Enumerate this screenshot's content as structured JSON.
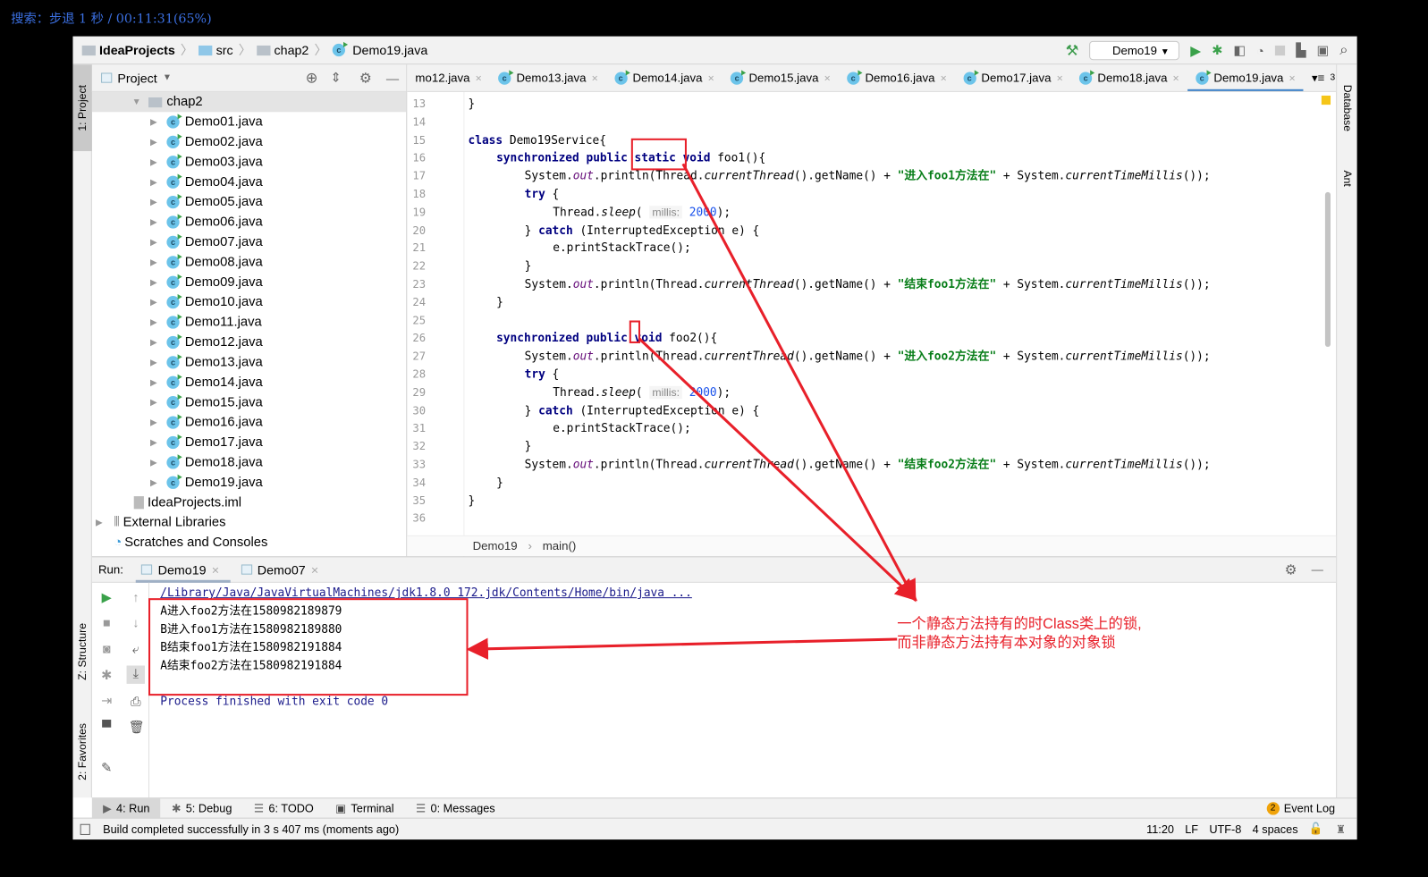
{
  "overlay": {
    "osd_text": "搜索：步退 1 秒 / 00:11:31(65%)"
  },
  "navbar": {
    "crumbs": [
      "IdeaProjects",
      "src",
      "chap2",
      "Demo19.java"
    ],
    "run_config": "Demo19"
  },
  "left_stripe": {
    "project": "1: Project",
    "structure": "Z: Structure",
    "favorites": "2: Favorites"
  },
  "right_stripe": {
    "database": "Database",
    "ant": "Ant"
  },
  "project": {
    "title": "Project",
    "folder": "chap2",
    "files": [
      "Demo01.java",
      "Demo02.java",
      "Demo03.java",
      "Demo04.java",
      "Demo05.java",
      "Demo06.java",
      "Demo07.java",
      "Demo08.java",
      "Demo09.java",
      "Demo10.java",
      "Demo11.java",
      "Demo12.java",
      "Demo13.java",
      "Demo14.java",
      "Demo15.java",
      "Demo16.java",
      "Demo17.java",
      "Demo18.java",
      "Demo19.java"
    ],
    "iml": "IdeaProjects.iml",
    "external": "External Libraries",
    "scratches": "Scratches and Consoles"
  },
  "tabs": {
    "items": [
      "mo12.java",
      "Demo13.java",
      "Demo14.java",
      "Demo15.java",
      "Demo16.java",
      "Demo17.java",
      "Demo18.java",
      "Demo19.java"
    ],
    "active": "Demo19.java",
    "overflow": "3"
  },
  "editor": {
    "lines": [
      {
        "n": "13",
        "indent": 0,
        "t": [
          [
            "p",
            "}"
          ]
        ]
      },
      {
        "n": "14",
        "indent": 0,
        "t": []
      },
      {
        "n": "15",
        "indent": 0,
        "t": [
          [
            "kw",
            "class"
          ],
          [
            "p",
            " Demo19Service{"
          ]
        ]
      },
      {
        "n": "16",
        "indent": 1,
        "t": [
          [
            "kw",
            "synchronized public static void"
          ],
          [
            "p",
            " foo1(){"
          ]
        ]
      },
      {
        "n": "17",
        "indent": 2,
        "t": [
          [
            "p",
            "System."
          ],
          [
            "fld",
            "out"
          ],
          [
            "p",
            ".println(Thread."
          ],
          [
            "it",
            "currentThread"
          ],
          [
            "p",
            "().getName() + "
          ],
          [
            "str",
            "\"进入foo1方法在\""
          ],
          [
            "p",
            " + System."
          ],
          [
            "it",
            "currentTimeMillis"
          ],
          [
            "p",
            "());"
          ]
        ]
      },
      {
        "n": "18",
        "indent": 2,
        "t": [
          [
            "kw",
            "try"
          ],
          [
            "p",
            " {"
          ]
        ]
      },
      {
        "n": "19",
        "indent": 3,
        "t": [
          [
            "p",
            "Thread."
          ],
          [
            "it",
            "sleep"
          ],
          [
            "p",
            "( "
          ],
          [
            "hint",
            "millis:"
          ],
          [
            "p",
            " "
          ],
          [
            "num",
            "2000"
          ],
          [
            "p",
            ");"
          ]
        ]
      },
      {
        "n": "20",
        "indent": 2,
        "t": [
          [
            "p",
            "} "
          ],
          [
            "kw",
            "catch"
          ],
          [
            "p",
            " (InterruptedException e) {"
          ]
        ]
      },
      {
        "n": "21",
        "indent": 3,
        "t": [
          [
            "p",
            "e.printStackTrace();"
          ]
        ]
      },
      {
        "n": "22",
        "indent": 2,
        "t": [
          [
            "p",
            "}"
          ]
        ]
      },
      {
        "n": "23",
        "indent": 2,
        "t": [
          [
            "p",
            "System."
          ],
          [
            "fld",
            "out"
          ],
          [
            "p",
            ".println(Thread."
          ],
          [
            "it",
            "currentThread"
          ],
          [
            "p",
            "().getName() + "
          ],
          [
            "str",
            "\"结束foo1方法在\""
          ],
          [
            "p",
            " + System."
          ],
          [
            "it",
            "currentTimeMillis"
          ],
          [
            "p",
            "());"
          ]
        ]
      },
      {
        "n": "24",
        "indent": 1,
        "t": [
          [
            "p",
            "}"
          ]
        ]
      },
      {
        "n": "25",
        "indent": 0,
        "t": []
      },
      {
        "n": "26",
        "indent": 1,
        "t": [
          [
            "kw",
            "synchronized public void"
          ],
          [
            "p",
            " foo2(){"
          ]
        ]
      },
      {
        "n": "27",
        "indent": 2,
        "t": [
          [
            "p",
            "System."
          ],
          [
            "fld",
            "out"
          ],
          [
            "p",
            ".println(Thread."
          ],
          [
            "it",
            "currentThread"
          ],
          [
            "p",
            "().getName() + "
          ],
          [
            "str",
            "\"进入foo2方法在\""
          ],
          [
            "p",
            " + System."
          ],
          [
            "it",
            "currentTimeMillis"
          ],
          [
            "p",
            "());"
          ]
        ]
      },
      {
        "n": "28",
        "indent": 2,
        "t": [
          [
            "kw",
            "try"
          ],
          [
            "p",
            " {"
          ]
        ]
      },
      {
        "n": "29",
        "indent": 3,
        "t": [
          [
            "p",
            "Thread."
          ],
          [
            "it",
            "sleep"
          ],
          [
            "p",
            "( "
          ],
          [
            "hint",
            "millis:"
          ],
          [
            "p",
            " "
          ],
          [
            "num",
            "2000"
          ],
          [
            "p",
            ");"
          ]
        ]
      },
      {
        "n": "30",
        "indent": 2,
        "t": [
          [
            "p",
            "} "
          ],
          [
            "kw",
            "catch"
          ],
          [
            "p",
            " (InterruptedException e) {"
          ]
        ]
      },
      {
        "n": "31",
        "indent": 3,
        "t": [
          [
            "p",
            "e.printStackTrace();"
          ]
        ]
      },
      {
        "n": "32",
        "indent": 2,
        "t": [
          [
            "p",
            "}"
          ]
        ]
      },
      {
        "n": "33",
        "indent": 2,
        "t": [
          [
            "p",
            "System."
          ],
          [
            "fld",
            "out"
          ],
          [
            "p",
            ".println(Thread."
          ],
          [
            "it",
            "currentThread"
          ],
          [
            "p",
            "().getName() + "
          ],
          [
            "str",
            "\"结束foo2方法在\""
          ],
          [
            "p",
            " + System."
          ],
          [
            "it",
            "currentTimeMillis"
          ],
          [
            "p",
            "());"
          ]
        ]
      },
      {
        "n": "34",
        "indent": 1,
        "t": [
          [
            "p",
            "}"
          ]
        ]
      },
      {
        "n": "35",
        "indent": 0,
        "t": [
          [
            "p",
            "}"
          ]
        ]
      },
      {
        "n": "36",
        "indent": 0,
        "t": []
      }
    ],
    "breadcrumb": [
      "Demo19",
      "main()"
    ]
  },
  "run": {
    "label": "Run:",
    "tabs": [
      "Demo19",
      "Demo07"
    ],
    "command": "/Library/Java/JavaVirtualMachines/jdk1.8.0_172.jdk/Contents/Home/bin/java ...",
    "output": [
      "A进入foo2方法在1580982189879",
      "B进入foo1方法在1580982189880",
      "B结束foo1方法在1580982191884",
      "A结束foo2方法在1580982191884"
    ],
    "exit": "Process finished with exit code 0"
  },
  "bottom_tools": [
    "4: Run",
    "5: Debug",
    "6: TODO",
    "Terminal",
    "0: Messages"
  ],
  "event_log": {
    "count": "2",
    "label": "Event Log"
  },
  "status": {
    "message": "Build completed successfully in 3 s 407 ms (moments ago)",
    "position": "11:20",
    "line_sep": "LF",
    "encoding": "UTF-8",
    "indent": "4 spaces"
  },
  "annotation": {
    "line1": "一个静态方法持有的时Class类上的锁,",
    "line2": "而非静态方法持有本对象的对象锁",
    "color": "#e8202a"
  }
}
